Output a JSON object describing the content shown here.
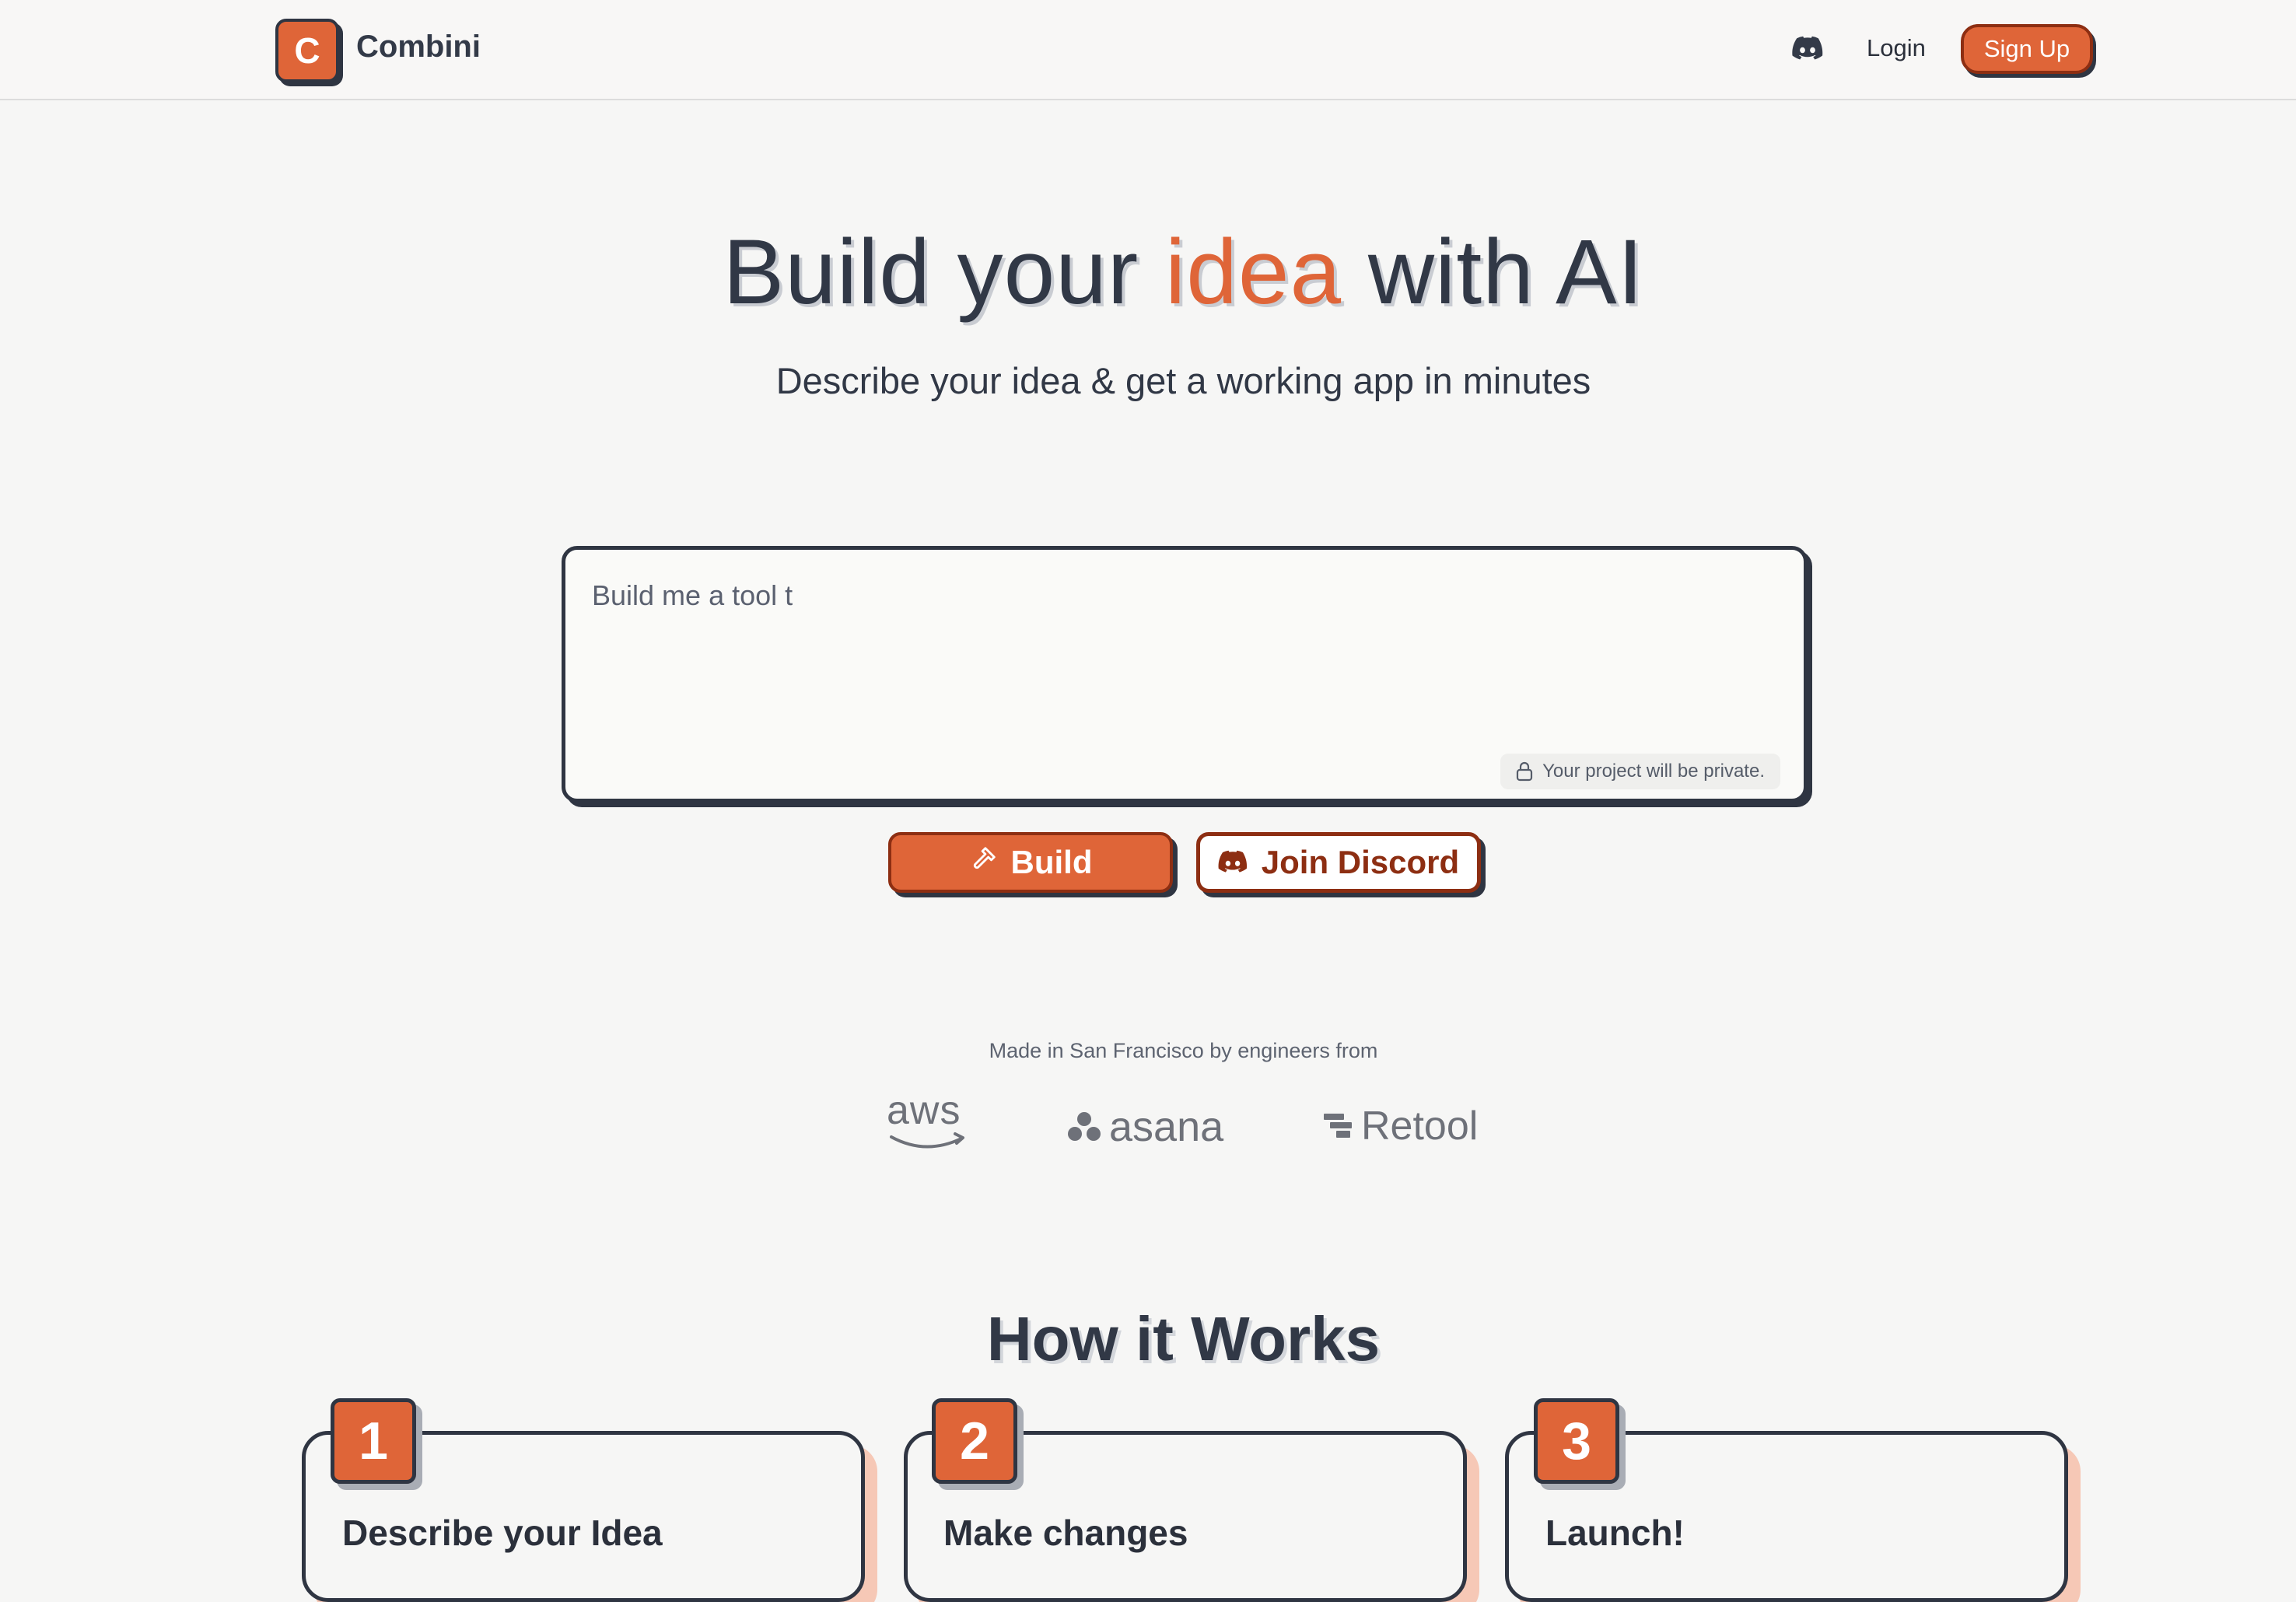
{
  "header": {
    "logo_letter": "C",
    "brand_name": "Combini",
    "login_label": "Login",
    "signup_label": "Sign Up",
    "discord_icon": "discord-icon"
  },
  "hero": {
    "title_pre": "Build your ",
    "title_accent": "idea",
    "title_post": " with AI",
    "subtitle": "Describe your idea & get a working app in minutes"
  },
  "prompt": {
    "value": "Build me a tool t",
    "privacy_note": "Your project will be private.",
    "build_label": "Build",
    "discord_label": "Join Discord"
  },
  "credibility": {
    "made_in": "Made in San Francisco by engineers from",
    "brands": [
      "aws",
      "asana",
      "Retool"
    ]
  },
  "how_it_works": {
    "title": "How it Works",
    "steps": [
      {
        "number": "1",
        "title": "Describe your Idea"
      },
      {
        "number": "2",
        "title": "Make changes"
      },
      {
        "number": "3",
        "title": "Launch!"
      }
    ]
  },
  "colors": {
    "accent": "#df6538",
    "accent_dark": "#8d2e12",
    "ink": "#2f3542",
    "background": "#f6f6f5"
  }
}
